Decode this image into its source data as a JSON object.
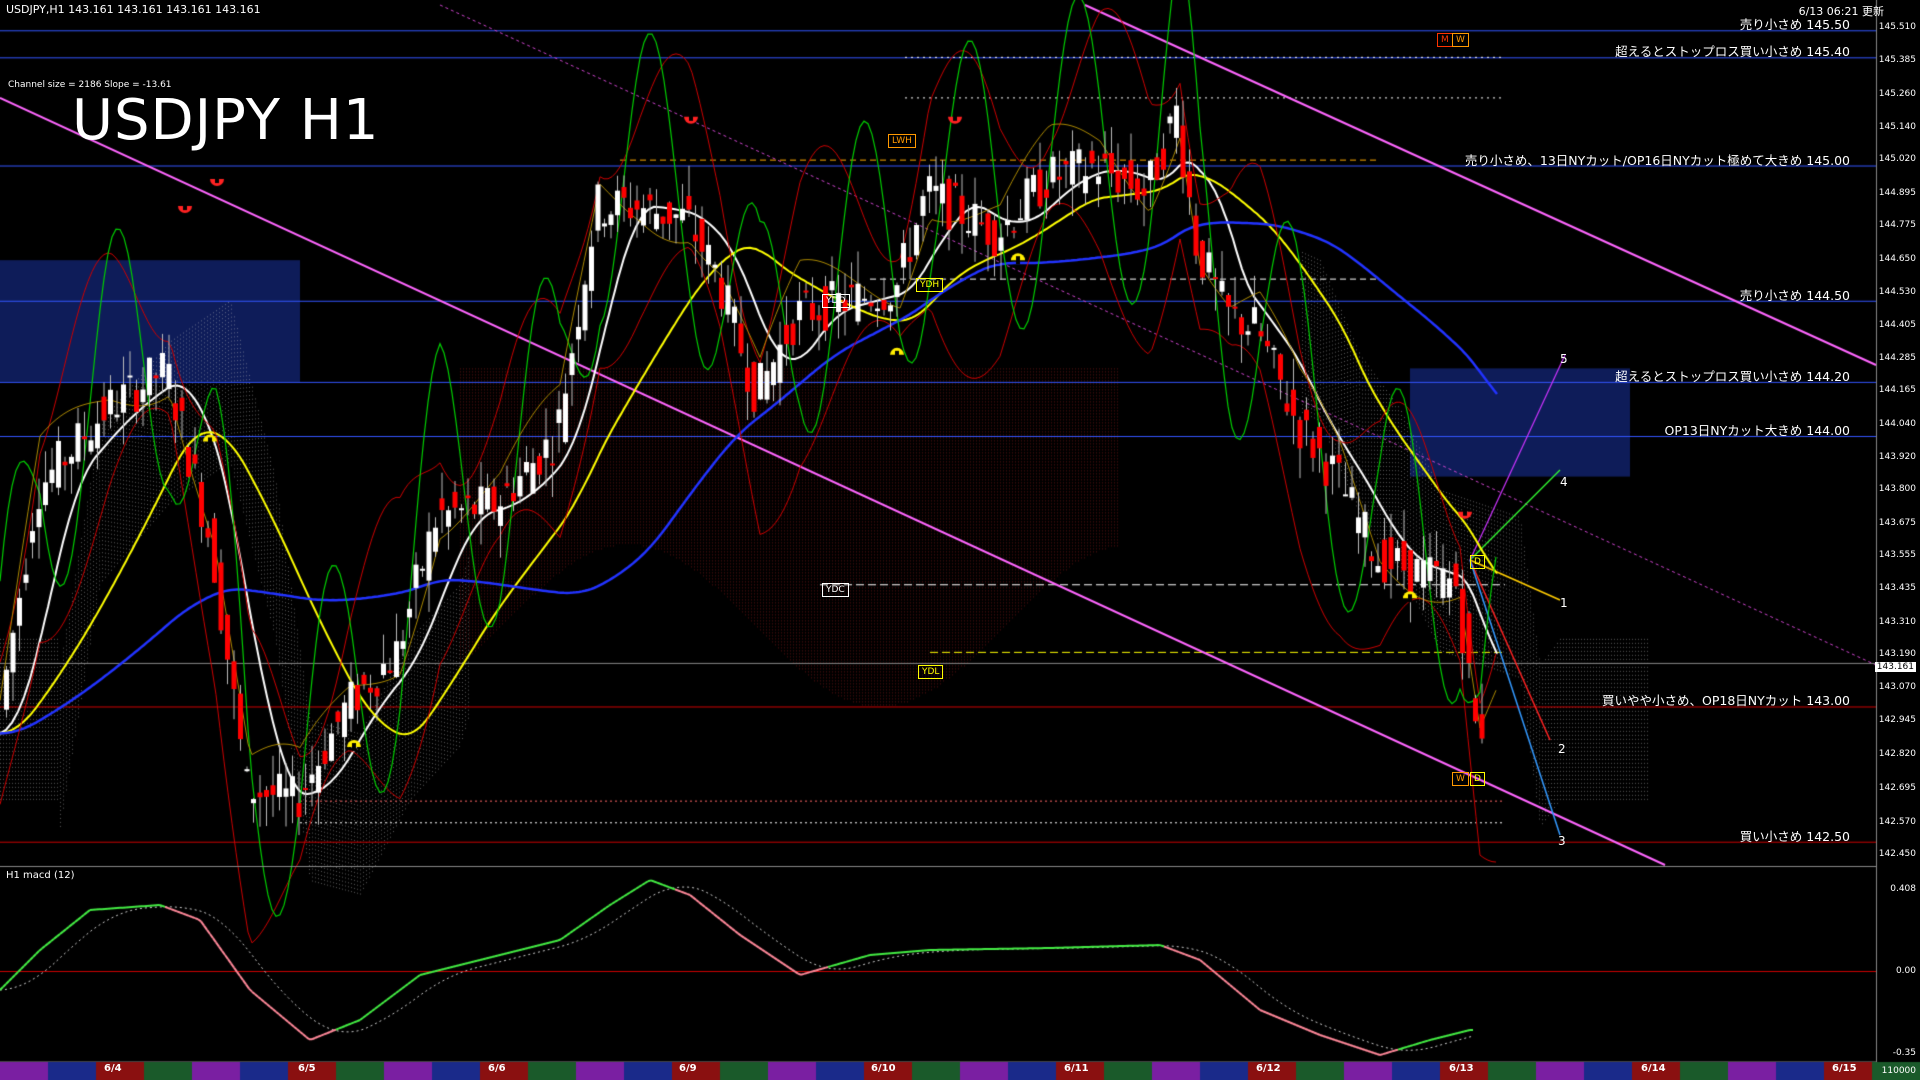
{
  "header": {
    "symbol_line": "USDJPY,H1  143.161 143.161 143.161 143.161",
    "updated": "6/13 06:21 更新",
    "channel_info": "Channel size = 2186 Slope = -13.61",
    "big_title": "USDJPY H1"
  },
  "levels": [
    {
      "label": "売り小さめ 145.50",
      "price": 145.5,
      "color": "#3355ff"
    },
    {
      "label": "超えるとストップロス買い小さめ 145.40",
      "price": 145.4,
      "color": "#3355ff"
    },
    {
      "label": "売り小さめ、13日NYカット/OP16日NYカット極めて大きめ 145.00",
      "price": 145.0,
      "color": "#3355ff"
    },
    {
      "label": "売り小さめ 144.50",
      "price": 144.5,
      "color": "#3355ff"
    },
    {
      "label": "超えるとストップロス買い小さめ 144.20",
      "price": 144.2,
      "color": "#3355ff"
    },
    {
      "label": "OP13日NYカット大きめ 144.00",
      "price": 144.0,
      "color": "#3355ff"
    },
    {
      "label": "買いやや小さめ、OP18日NYカット 143.00",
      "price": 143.0,
      "color": "#cc0000"
    },
    {
      "label": "買い小さめ 142.50",
      "price": 142.5,
      "color": "#cc0000"
    }
  ],
  "price_axis": [
    "145.510",
    "145.385",
    "145.260",
    "145.140",
    "145.020",
    "144.895",
    "144.775",
    "144.650",
    "144.530",
    "144.405",
    "144.285",
    "144.165",
    "144.040",
    "143.920",
    "143.800",
    "143.675",
    "143.555",
    "143.435",
    "143.310",
    "143.190",
    "143.070",
    "142.945",
    "142.820",
    "142.695",
    "142.570",
    "142.450"
  ],
  "current_price": "143.161",
  "tags": [
    {
      "text": "LWH",
      "color": "#ff9900"
    },
    {
      "text": "YDO",
      "color": "#ffffff"
    },
    {
      "text": "YDH",
      "color": "#ffff00"
    },
    {
      "text": "YDC",
      "color": "#ffffff"
    },
    {
      "text": "YDL",
      "color": "#ffff00"
    },
    {
      "text": "M",
      "color": "#ff3300"
    },
    {
      "text": "W",
      "color": "#ff9900"
    },
    {
      "text": "D",
      "color": "#ffff00"
    },
    {
      "text": "W",
      "color": "#ff9900"
    },
    {
      "text": "D",
      "color": "#ffff00"
    }
  ],
  "wave_labels": [
    "1",
    "2",
    "3",
    "4",
    "5"
  ],
  "macd": {
    "title": "H1  macd (12)",
    "axis": [
      "0.408",
      "0.00",
      "-0.35"
    ],
    "bottom": "110000"
  },
  "dates": [
    "6/4",
    "6/5",
    "6/6",
    "6/9",
    "6/10",
    "6/11",
    "6/12",
    "6/13",
    "6/14",
    "6/15"
  ],
  "colors": {
    "background": "#000000",
    "bull": "#ffffff",
    "bear": "#ff0000",
    "grid_blue": "#3355ff",
    "ma_fast": "#ffffff",
    "ma_mid": "#ffff00",
    "ma_slow": "#2233ff",
    "channel": "#ff66ff",
    "macd_main": "#44ee44",
    "macd_neg": "#ff8899"
  }
}
